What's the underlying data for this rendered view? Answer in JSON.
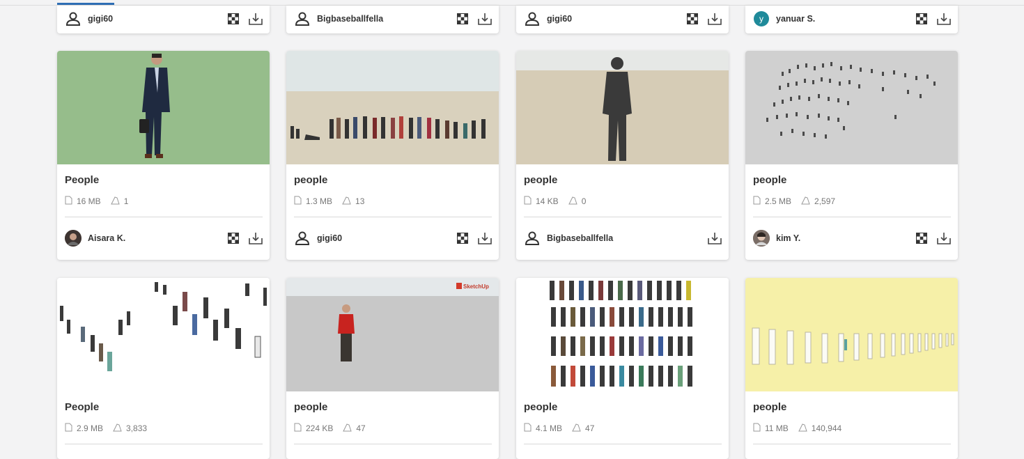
{
  "colors": {
    "accent": "#2f6fb6",
    "avatar_teal": "#1f8a9a"
  },
  "top_row": [
    {
      "author": "gigi60",
      "avatar": "user-icon",
      "vr": true
    },
    {
      "author": "Bigbaseballfella",
      "avatar": "user-icon",
      "vr": true
    },
    {
      "author": "gigi60",
      "avatar": "user-icon",
      "vr": true
    },
    {
      "author": "yanuar S.",
      "avatar": "letter",
      "avatar_letter": "y",
      "vr": true
    }
  ],
  "row1": [
    {
      "title": "People",
      "size": "16 MB",
      "downloads": "1",
      "author": "Aisara K.",
      "avatar": "photo",
      "vr": true
    },
    {
      "title": "people",
      "size": "1.3 MB",
      "downloads": "13",
      "author": "gigi60",
      "avatar": "user-icon",
      "vr": true
    },
    {
      "title": "people",
      "size": "14 KB",
      "downloads": "0",
      "author": "Bigbaseballfella",
      "avatar": "user-icon",
      "vr": false
    },
    {
      "title": "people",
      "size": "2.5 MB",
      "downloads": "2,597",
      "author": "kim Y.",
      "avatar": "photo",
      "vr": true
    }
  ],
  "row2": [
    {
      "title": "People",
      "size": "2.9 MB",
      "downloads": "3,833"
    },
    {
      "title": "people",
      "size": "224 KB",
      "downloads": "47",
      "thumb_logo": "SketchUp"
    },
    {
      "title": "people",
      "size": "4.1 MB",
      "downloads": "47"
    },
    {
      "title": "people",
      "size": "11 MB",
      "downloads": "140,944"
    }
  ]
}
